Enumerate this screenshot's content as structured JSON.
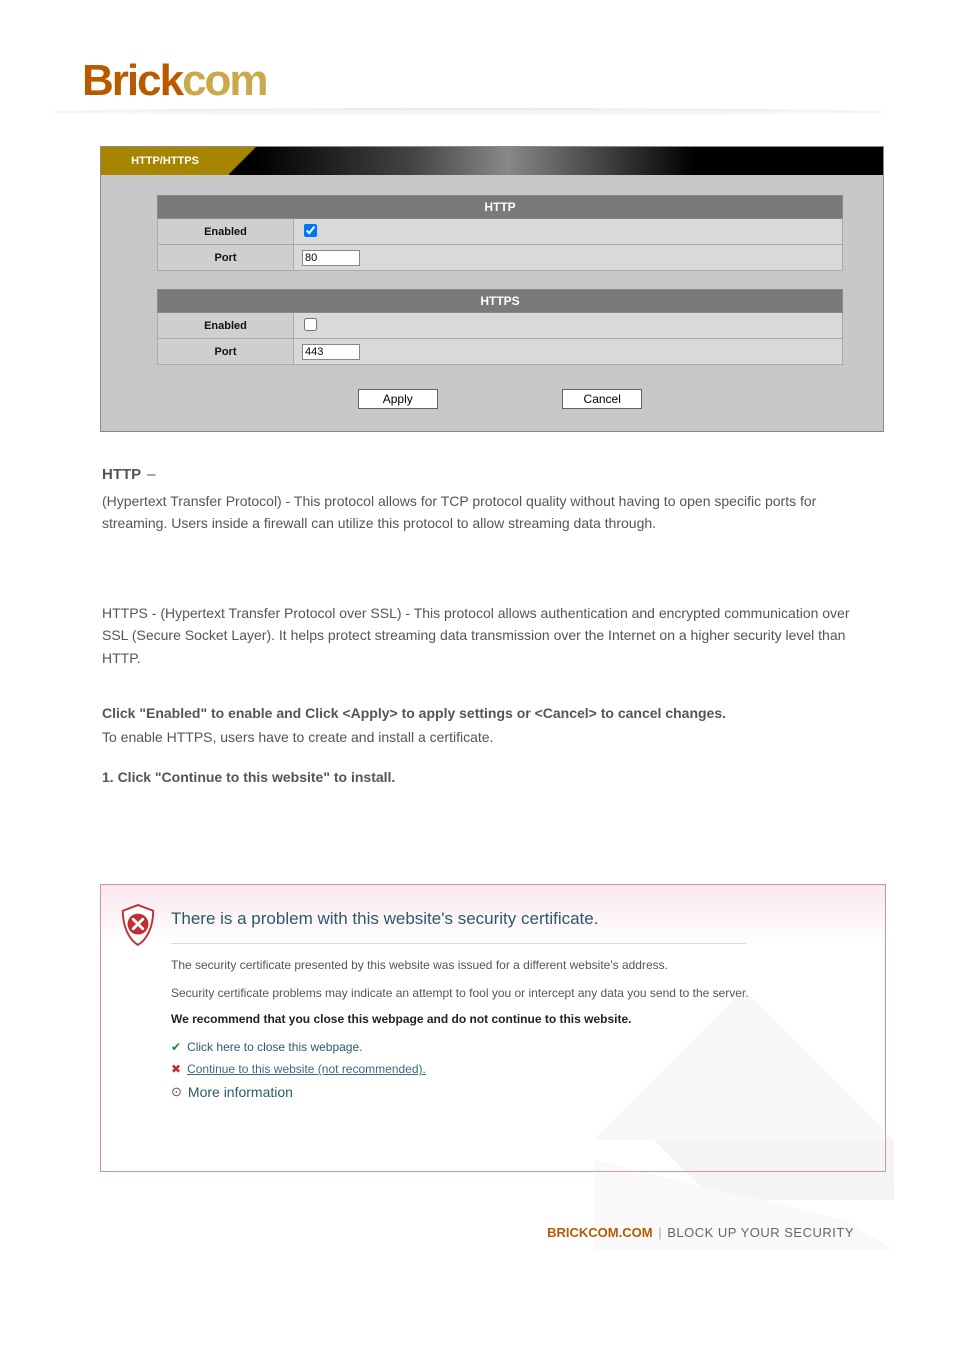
{
  "logo": {
    "part1": "Brick",
    "part2": "com"
  },
  "panel": {
    "tab_label": "HTTP/HTTPS",
    "http": {
      "title": "HTTP",
      "enabled_label": "Enabled",
      "enabled_value": true,
      "port_label": "Port",
      "port_value": "80"
    },
    "https": {
      "title": "HTTPS",
      "enabled_label": "Enabled",
      "enabled_value": false,
      "port_label": "Port",
      "port_value": "443"
    },
    "apply_label": "Apply",
    "cancel_label": "Cancel"
  },
  "text": {
    "section_title_http": "HTTP",
    "section_dash": "–",
    "p1": "(Hypertext Transfer Protocol) - This protocol allows for TCP protocol quality without having to open specific ports for streaming. Users inside a firewall can utilize this protocol to allow streaming data through.",
    "p2": "HTTPS - (Hypertext Transfer Protocol over SSL) - This protocol allows authentication and encrypted communication over SSL (Secure Socket Layer). It helps protect streaming data transmission over the Internet on a higher security level than HTTP.",
    "p3": "Click \"Enabled\" to enable and Click <Apply> to apply settings or <Cancel> to cancel changes.",
    "p4": "To enable HTTPS, users have to create and install a certificate.",
    "p5": "1. Click \"Continue to this website\" to install.",
    "p6": ""
  },
  "warning": {
    "title": "There is a problem with this website's security certificate.",
    "line1": "The security certificate presented by this website was issued for a different website's address.",
    "line2": "Security certificate problems may indicate an attempt to fool you or intercept any data you send to the server.",
    "recommend": "We recommend that you close this webpage and do not continue to this website.",
    "close_link": "Click here to close this webpage.",
    "continue_link": "Continue to this website (not recommended).",
    "more_link": "More information"
  },
  "footer": {
    "brand": "BRICKCOM.COM",
    "sep": "|",
    "slogan": "BLOCK UP YOUR SECURITY"
  }
}
